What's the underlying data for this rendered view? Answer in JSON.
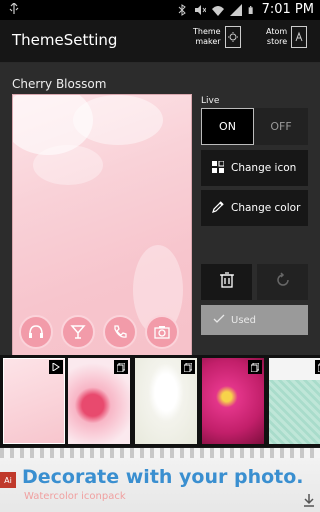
{
  "status_bar": {
    "time": "7:01 PM"
  },
  "header": {
    "title": "ThemeSetting",
    "theme_maker_label_1": "Theme",
    "theme_maker_label_2": "maker",
    "atom_store_label_1": "Atom",
    "atom_store_label_2": "store"
  },
  "theme": {
    "name": "Cherry Blossom"
  },
  "live": {
    "label": "Live",
    "on_label": "ON",
    "off_label": "OFF",
    "selected": "ON"
  },
  "actions": {
    "change_icon": "Change icon",
    "change_color": "Change color",
    "used": "Used"
  },
  "thumbnails": [
    {
      "name": "cherry-blossom-theme",
      "badge": "play-icon",
      "selected": true
    },
    {
      "name": "pink-flower-theme",
      "badge": "copy-icon",
      "selected": false
    },
    {
      "name": "white-tulip-theme",
      "badge": "copy-icon",
      "selected": false
    },
    {
      "name": "pink-daisy-theme",
      "badge": "copy-icon",
      "selected": false
    },
    {
      "name": "mint-pattern-theme",
      "badge": "copy-icon",
      "selected": false
    }
  ],
  "ad": {
    "headline": "Decorate with your photo.",
    "subtitle": "Watercolor iconpack",
    "logo_text": "Ai"
  },
  "colors": {
    "accent_pink": "#f29ba9",
    "ad_blue": "#3a8fd0",
    "panel_bg": "#2c2c2c",
    "header_bg": "#161616"
  }
}
